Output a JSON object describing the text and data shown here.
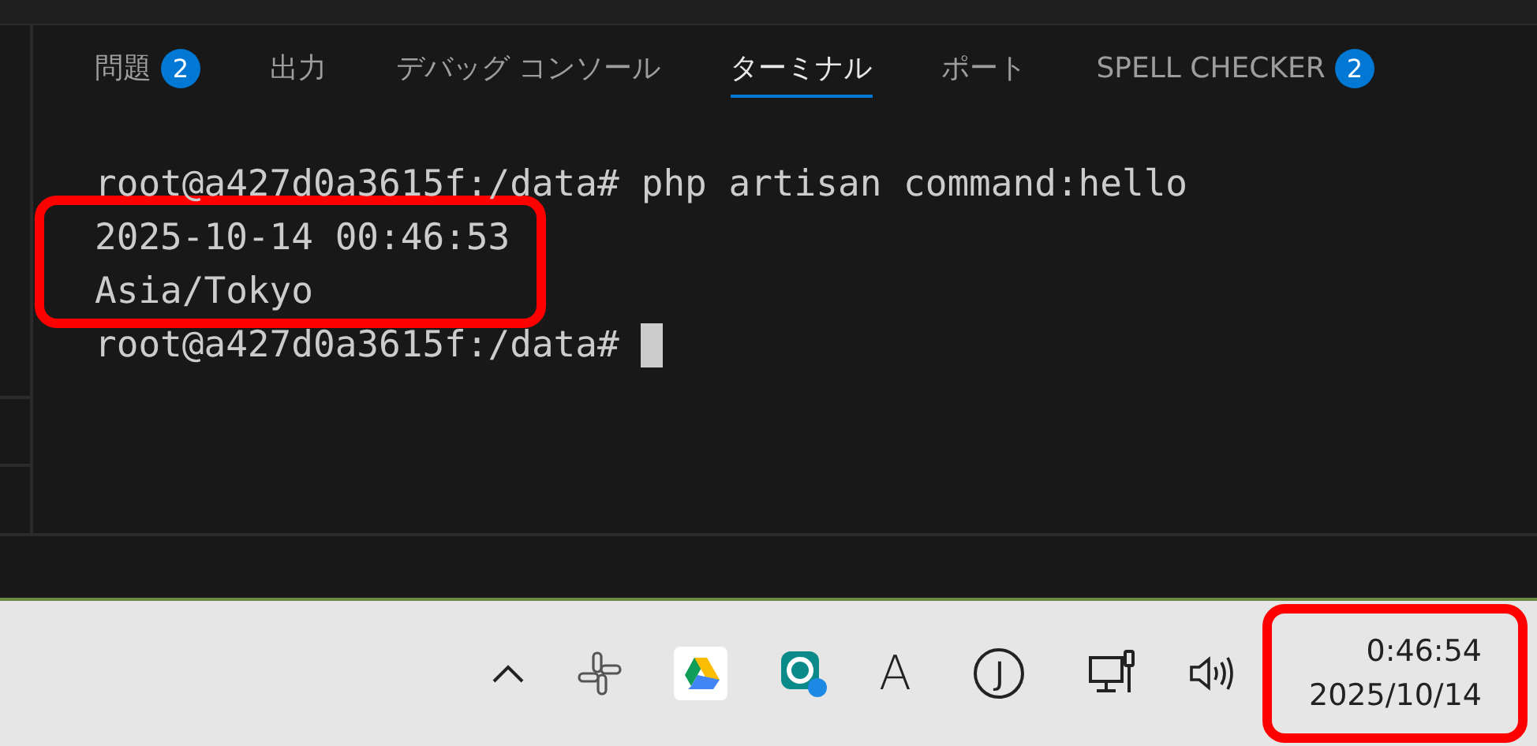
{
  "panel_tabs": [
    {
      "label": "問題",
      "badge": "2",
      "selected": false
    },
    {
      "label": "出力",
      "selected": false
    },
    {
      "label": "デバッグ コンソール",
      "selected": false
    },
    {
      "label": "ターミナル",
      "selected": true
    },
    {
      "label": "ポート",
      "selected": false
    },
    {
      "label": "SPELL CHECKER",
      "badge": "2",
      "selected": false
    }
  ],
  "terminal": {
    "lines": [
      {
        "prompt": "root@a427d0a3615f:/data#",
        "command": "php artisan command:hello"
      },
      {
        "text": "2025-10-14 00:46:53"
      },
      {
        "text": "Asia/Tokyo"
      },
      {
        "prompt": "root@a427d0a3615f:/data#",
        "cursor": true
      }
    ]
  },
  "taskbar": {
    "tray": [
      {
        "kind": "caret"
      },
      {
        "kind": "slack"
      },
      {
        "kind": "drive"
      },
      {
        "kind": "eset"
      },
      {
        "kind": "letter",
        "text": "A"
      },
      {
        "kind": "circle-letter",
        "text": "J"
      },
      {
        "kind": "network"
      },
      {
        "kind": "speaker"
      }
    ],
    "clock": {
      "time": "0:46:54",
      "date": "2025/10/14"
    }
  },
  "highlights": {
    "output": true,
    "clock": true
  }
}
